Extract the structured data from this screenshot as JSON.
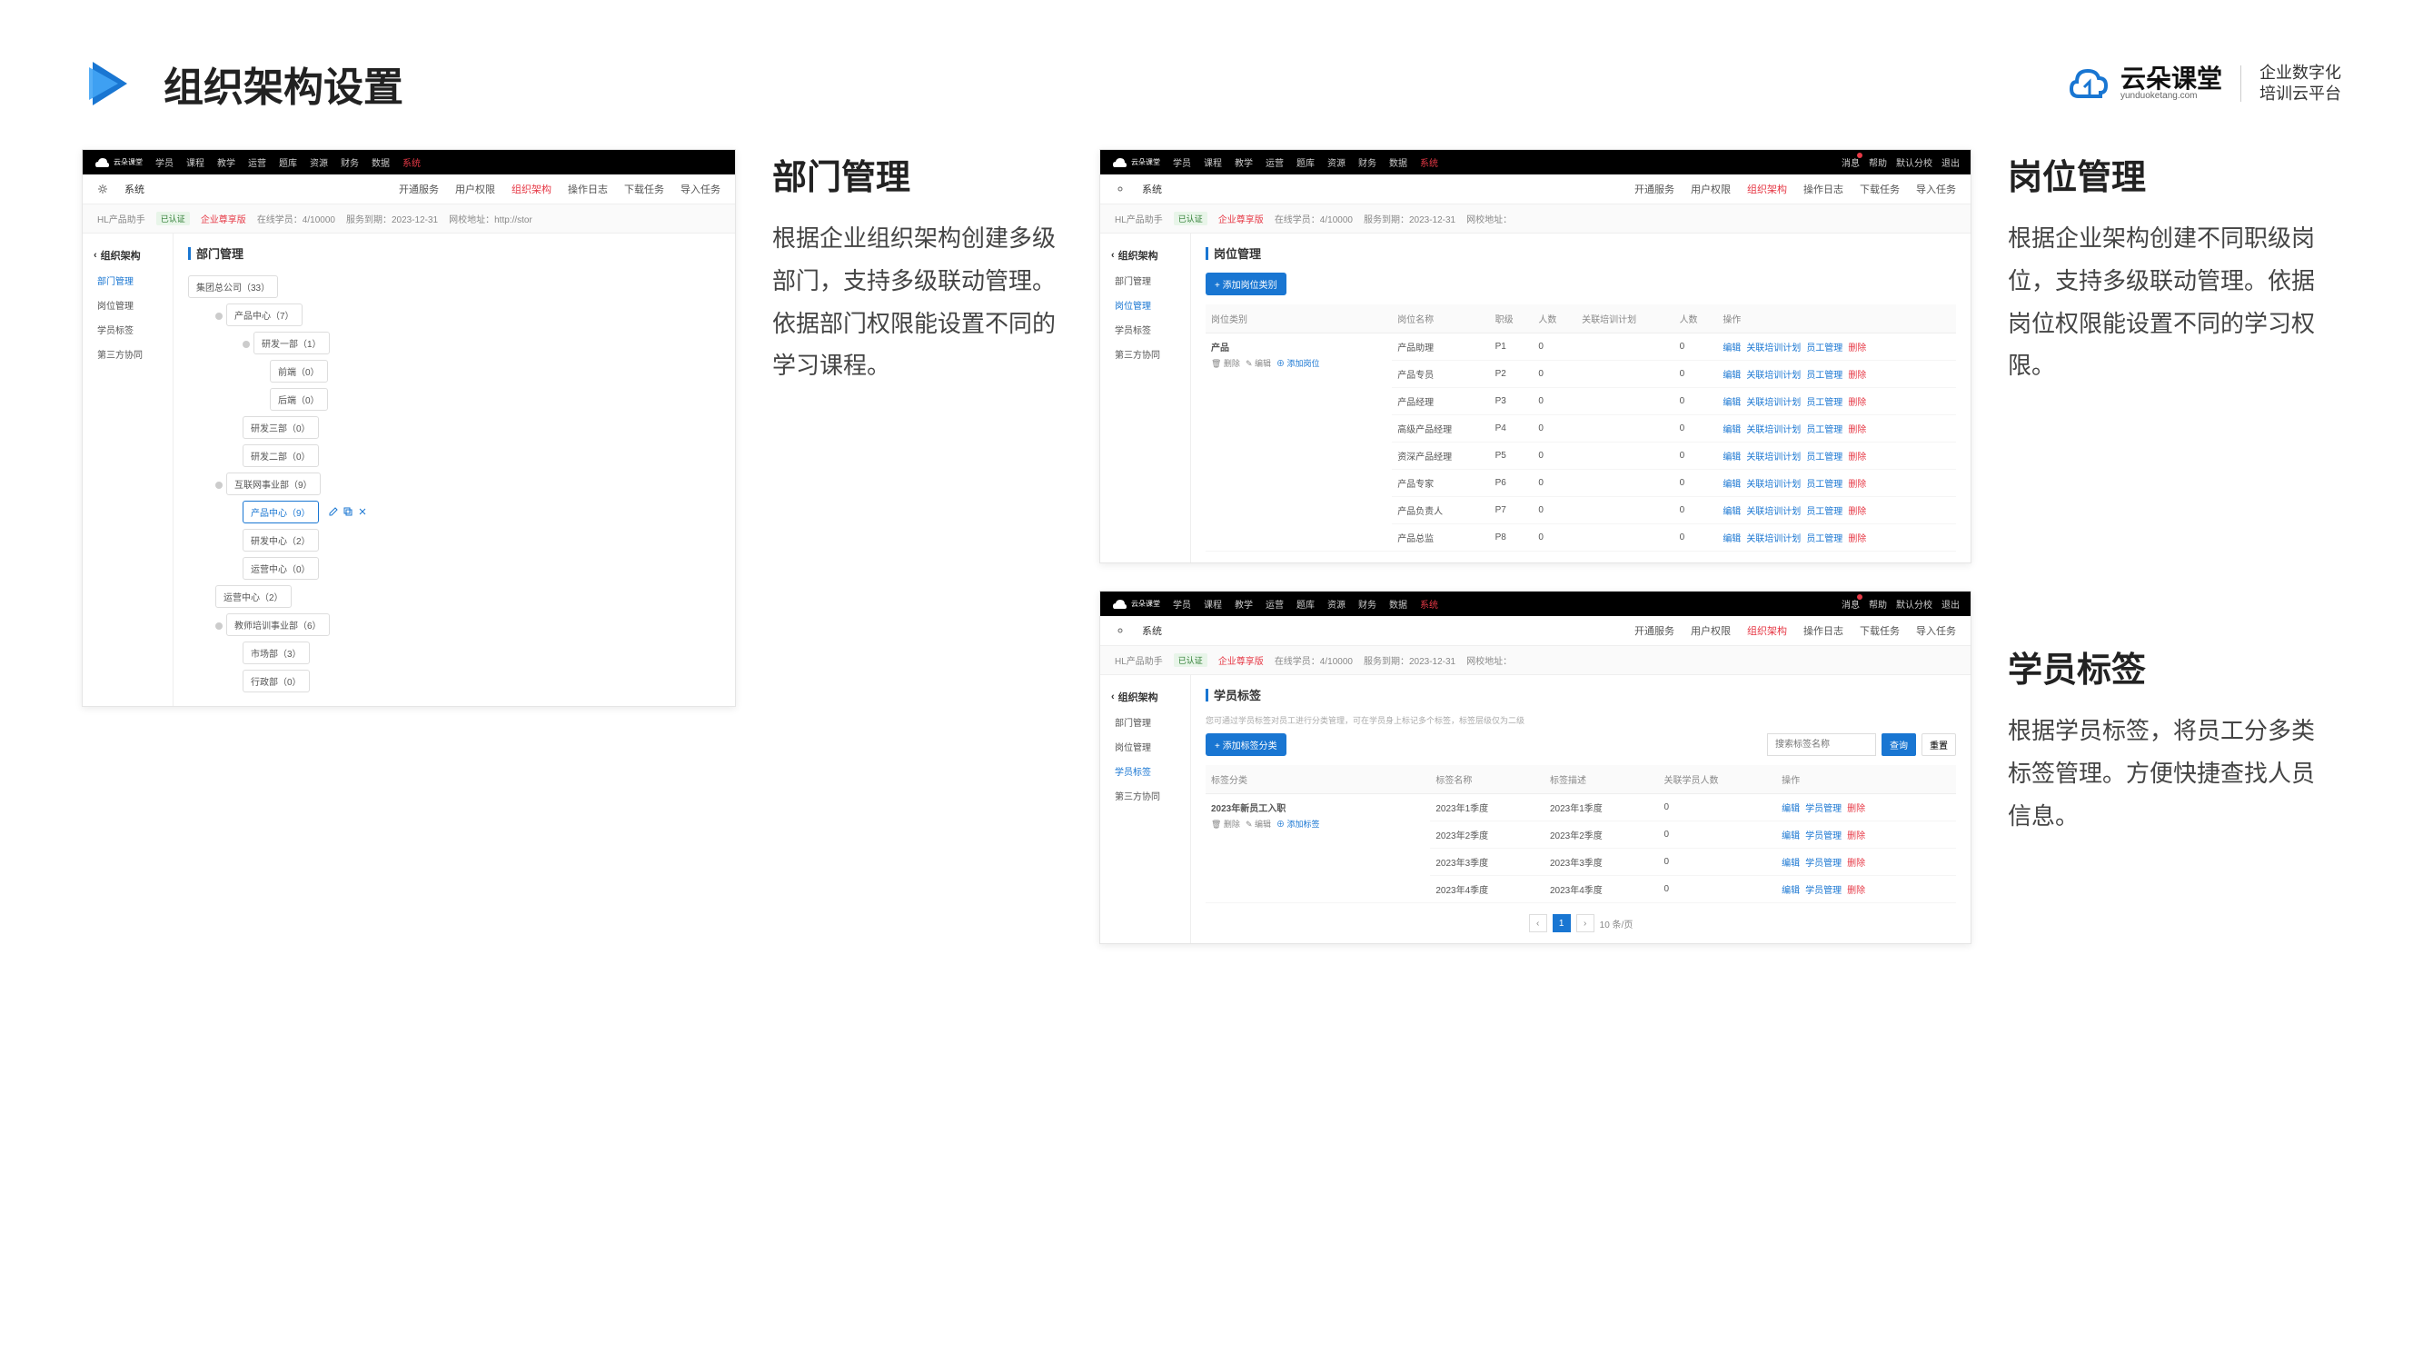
{
  "header": {
    "title": "组织架构设置",
    "brand_cn": "云朵课堂",
    "brand_en": "yunduoketang.com",
    "tagline_l1": "企业数字化",
    "tagline_l2": "培训云平台"
  },
  "sections": {
    "dept": {
      "title": "部门管理",
      "desc": "根据企业组织架构创建多级部门，支持多级联动管理。依据部门权限能设置不同的学习课程。"
    },
    "job": {
      "title": "岗位管理",
      "desc": "根据企业架构创建不同职级岗位，支持多级联动管理。依据岗位权限能设置不同的学习权限。"
    },
    "tag": {
      "title": "学员标签",
      "desc": "根据学员标签，将员工分多类标签管理。方便快捷查找人员信息。"
    }
  },
  "topnav": [
    "学员",
    "课程",
    "教学",
    "运营",
    "题库",
    "资源",
    "财务",
    "数据",
    "系统"
  ],
  "topnav_hl": 8,
  "topright": {
    "msg": "消息",
    "help": "帮助",
    "branch": "默认分校",
    "exit": "退出"
  },
  "subnav": {
    "system": "系统",
    "items": [
      "开通服务",
      "用户权限",
      "组织架构",
      "操作日志",
      "下载任务",
      "导入任务"
    ],
    "active": 2
  },
  "status": {
    "product": "HL产品助手",
    "verified": "已认证",
    "version": "企业尊享版",
    "online": "在线学员：4/10000",
    "expire": "服务到期：2023-12-31",
    "url_label": "网校地址：http://stor"
  },
  "status2": {
    "url_label": "网校地址："
  },
  "sidebar": {
    "title": "组织架构",
    "items": [
      "部门管理",
      "岗位管理",
      "学员标签",
      "第三方协同"
    ]
  },
  "shot1": {
    "main_title": "部门管理",
    "tree": {
      "root": "集团总公司（33）",
      "c1": "产品中心（7）",
      "c1a": "研发一部（1）",
      "c1a1": "前端（0）",
      "c1a2": "后端（0）",
      "c1b": "研发三部（0）",
      "c1c": "研发二部（0）",
      "c2": "互联网事业部（9）",
      "c2a": "产品中心（9）",
      "c2b": "研发中心（2）",
      "c2c": "运营中心（0）",
      "c3": "运营中心（2）",
      "c4": "教师培训事业部（6）",
      "c4a": "市场部（3）",
      "c4b": "行政部（0）"
    }
  },
  "shot2": {
    "main_title": "岗位管理",
    "add_btn": "+ 添加岗位类别",
    "headers": [
      "岗位类别",
      "岗位名称",
      "职级",
      "人数",
      "关联培训计划",
      "人数",
      "操作"
    ],
    "group": "产品",
    "group_actions": "删除 编辑 添加岗位",
    "rows": [
      {
        "name": "产品助理",
        "level": "P1",
        "n1": 0,
        "n2": 0
      },
      {
        "name": "产品专员",
        "level": "P2",
        "n1": 0,
        "n2": 0
      },
      {
        "name": "产品经理",
        "level": "P3",
        "n1": 0,
        "n2": 0
      },
      {
        "name": "高级产品经理",
        "level": "P4",
        "n1": 0,
        "n2": 0
      },
      {
        "name": "资深产品经理",
        "level": "P5",
        "n1": 0,
        "n2": 0
      },
      {
        "name": "产品专家",
        "level": "P6",
        "n1": 0,
        "n2": 0
      },
      {
        "name": "产品负责人",
        "level": "P7",
        "n1": 0,
        "n2": 0
      },
      {
        "name": "产品总监",
        "level": "P8",
        "n1": 0,
        "n2": 0
      }
    ],
    "ops": {
      "edit": "编辑",
      "plan": "关联培训计划",
      "emp": "员工管理",
      "del": "删除"
    }
  },
  "shot3": {
    "main_title": "学员标签",
    "help": "您可通过学员标签对员工进行分类管理，可在学员身上标记多个标签，标签层级仅为二级",
    "add_btn": "+ 添加标签分类",
    "search_ph": "搜索标签名称",
    "btn_search": "查询",
    "btn_reset": "重置",
    "headers": [
      "标签分类",
      "标签名称",
      "标签描述",
      "关联学员人数",
      "操作"
    ],
    "group": "2023年新员工入职",
    "group_actions": "删除 编辑 添加标签",
    "rows": [
      {
        "name": "2023年1季度",
        "desc": "2023年1季度",
        "n": 0
      },
      {
        "name": "2023年2季度",
        "desc": "2023年2季度",
        "n": 0
      },
      {
        "name": "2023年3季度",
        "desc": "2023年3季度",
        "n": 0
      },
      {
        "name": "2023年4季度",
        "desc": "2023年4季度",
        "n": 0
      }
    ],
    "ops": {
      "edit": "编辑",
      "emp": "学员管理",
      "del": "删除"
    },
    "page_info": "10 条/页"
  }
}
